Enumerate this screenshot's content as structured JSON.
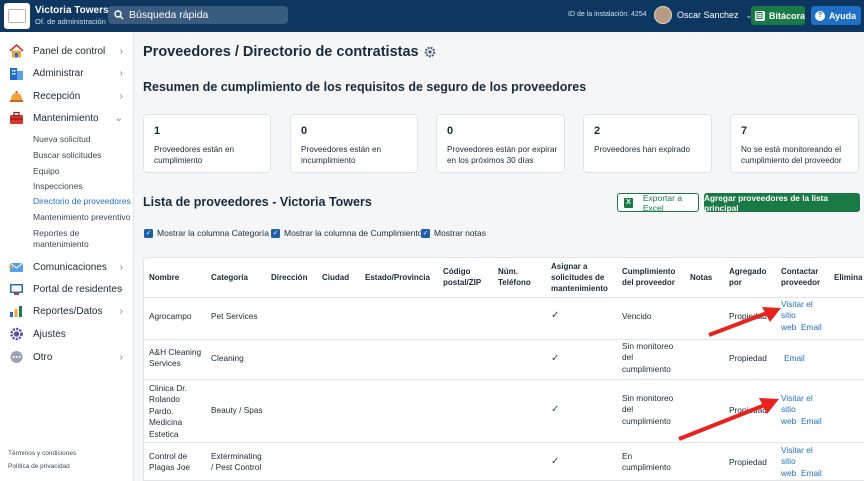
{
  "app": {
    "name": "Victoria Towers",
    "subtitle": "Of. de administración",
    "search_placeholder": "Búsqueda rápida",
    "install_id": "ID de la instalación: 4254",
    "user_name": "Oscar Sanchez",
    "bitacora_label": "Bitácora",
    "ayuda_label": "Ayuda",
    "colors": {
      "topbar": "#0d3760",
      "accent_green": "#1a7a45",
      "link_blue": "#1f6fc6",
      "arrow_red": "#e8231f"
    }
  },
  "sidebar": {
    "items": [
      {
        "label": "Panel de control",
        "icon": "house-icon"
      },
      {
        "label": "Administrar",
        "icon": "building-icon"
      },
      {
        "label": "Recepción",
        "icon": "bell-icon"
      },
      {
        "label": "Mantenimiento",
        "icon": "toolbox-icon"
      }
    ],
    "sub_items": [
      "Nueva solicitud",
      "Buscar solicitudes",
      "Equipo",
      "Inspecciones",
      "Directorio de proveedores",
      "Mantenimiento preventivo",
      "Reportes de",
      "mantenimiento"
    ],
    "items2": [
      {
        "label": "Comunicaciones",
        "icon": "envelope-icon"
      },
      {
        "label": "Portal de residentes",
        "icon": "portal-icon"
      },
      {
        "label": "Reportes/Datos",
        "icon": "bar-chart-icon"
      },
      {
        "label": "Ajustes",
        "icon": "gear-icon"
      },
      {
        "label": "Otro",
        "icon": "more-icon"
      }
    ],
    "footer": {
      "terms": "Términos y condiciones",
      "privacy": "Política de privacidad"
    }
  },
  "main": {
    "title": "Proveedores / Directorio de contratistas",
    "summary_title": "Resumen de cumplimiento de los requisitos de seguro de los proveedores",
    "cards": [
      {
        "num": "1",
        "l1": "Proveedores están en",
        "l2": "cumplimiento"
      },
      {
        "num": "0",
        "l1": "Proveedores están en",
        "l2": "incumplimiento"
      },
      {
        "num": "0",
        "l1": "Proveedores están por expirar",
        "l2": "en los próximos 30 días"
      },
      {
        "num": "2",
        "l1": "Proveedores han expirado",
        "l2": ""
      },
      {
        "num": "7",
        "l1": "No se está monitoreando el",
        "l2": "cumplimiento del proveedor"
      }
    ],
    "list_title": "Lista de proveedores - Victoria Towers",
    "export_label": "Exportar a Excel",
    "add_label": "Agregar proveedores de la lista principal",
    "checks": [
      "Mostrar la columna Categoría",
      "Mostrar la columna de Cumplimiento",
      "Mostrar notas"
    ]
  },
  "table": {
    "headers": {
      "nombre": "Nombre",
      "categoria": "Categoría",
      "direccion": "Dirección",
      "ciudad": "Ciudad",
      "estado": "Estado/Provincia",
      "codigo_1": "Código",
      "codigo_2": "postal/ZIP",
      "telefono_1": "Núm.",
      "telefono_2": "Teléfono",
      "asignar_1": "Asignar a",
      "asignar_2": "solicitudes de",
      "asignar_3": "mantenimiento",
      "cumplimiento_1": "Cumplimiento",
      "cumplimiento_2": "del proveedor",
      "notas": "Notas",
      "agregado_1": "Agregado",
      "agregado_2": "por",
      "contactar_1": "Contactar",
      "contactar_2": "proveedor",
      "eliminar": "Elimina"
    },
    "rows": [
      {
        "nombre": [
          "Agrocampo"
        ],
        "categoria": [
          "Pet Services"
        ],
        "cumplimiento": [
          "Vencido"
        ],
        "agregado": "Propiedad",
        "sitio": [
          "Visitar el",
          "sitio"
        ],
        "web": "web",
        "email": "Email"
      },
      {
        "nombre": [
          "A&H Cleaning",
          "Services"
        ],
        "categoria": [
          "Cleaning"
        ],
        "cumplimiento": [
          "Sin monitoreo",
          "del",
          "cumplimiento"
        ],
        "agregado": "Propiedad",
        "sitio": [],
        "web": "",
        "email": "Email"
      },
      {
        "nombre": [
          "Clinica Dr.",
          "Rolando",
          "Pardo.",
          "Medicina",
          "Estetica"
        ],
        "categoria": [
          "Beauty / Spas"
        ],
        "cumplimiento": [
          "Sin monitoreo",
          "del",
          "cumplimiento"
        ],
        "agregado": "Propiedad",
        "sitio": [
          "Visitar el",
          "sitio"
        ],
        "web": "web",
        "email": "Email"
      },
      {
        "nombre": [
          "Control de",
          "Plagas Joe"
        ],
        "categoria": [
          "Exterminating",
          "/ Pest Control"
        ],
        "cumplimiento": [
          "En",
          "cumplimiento"
        ],
        "agregado": "Propiedad",
        "sitio": [
          "Visitar el",
          "sitio"
        ],
        "web": "web",
        "email": "Email"
      }
    ]
  }
}
